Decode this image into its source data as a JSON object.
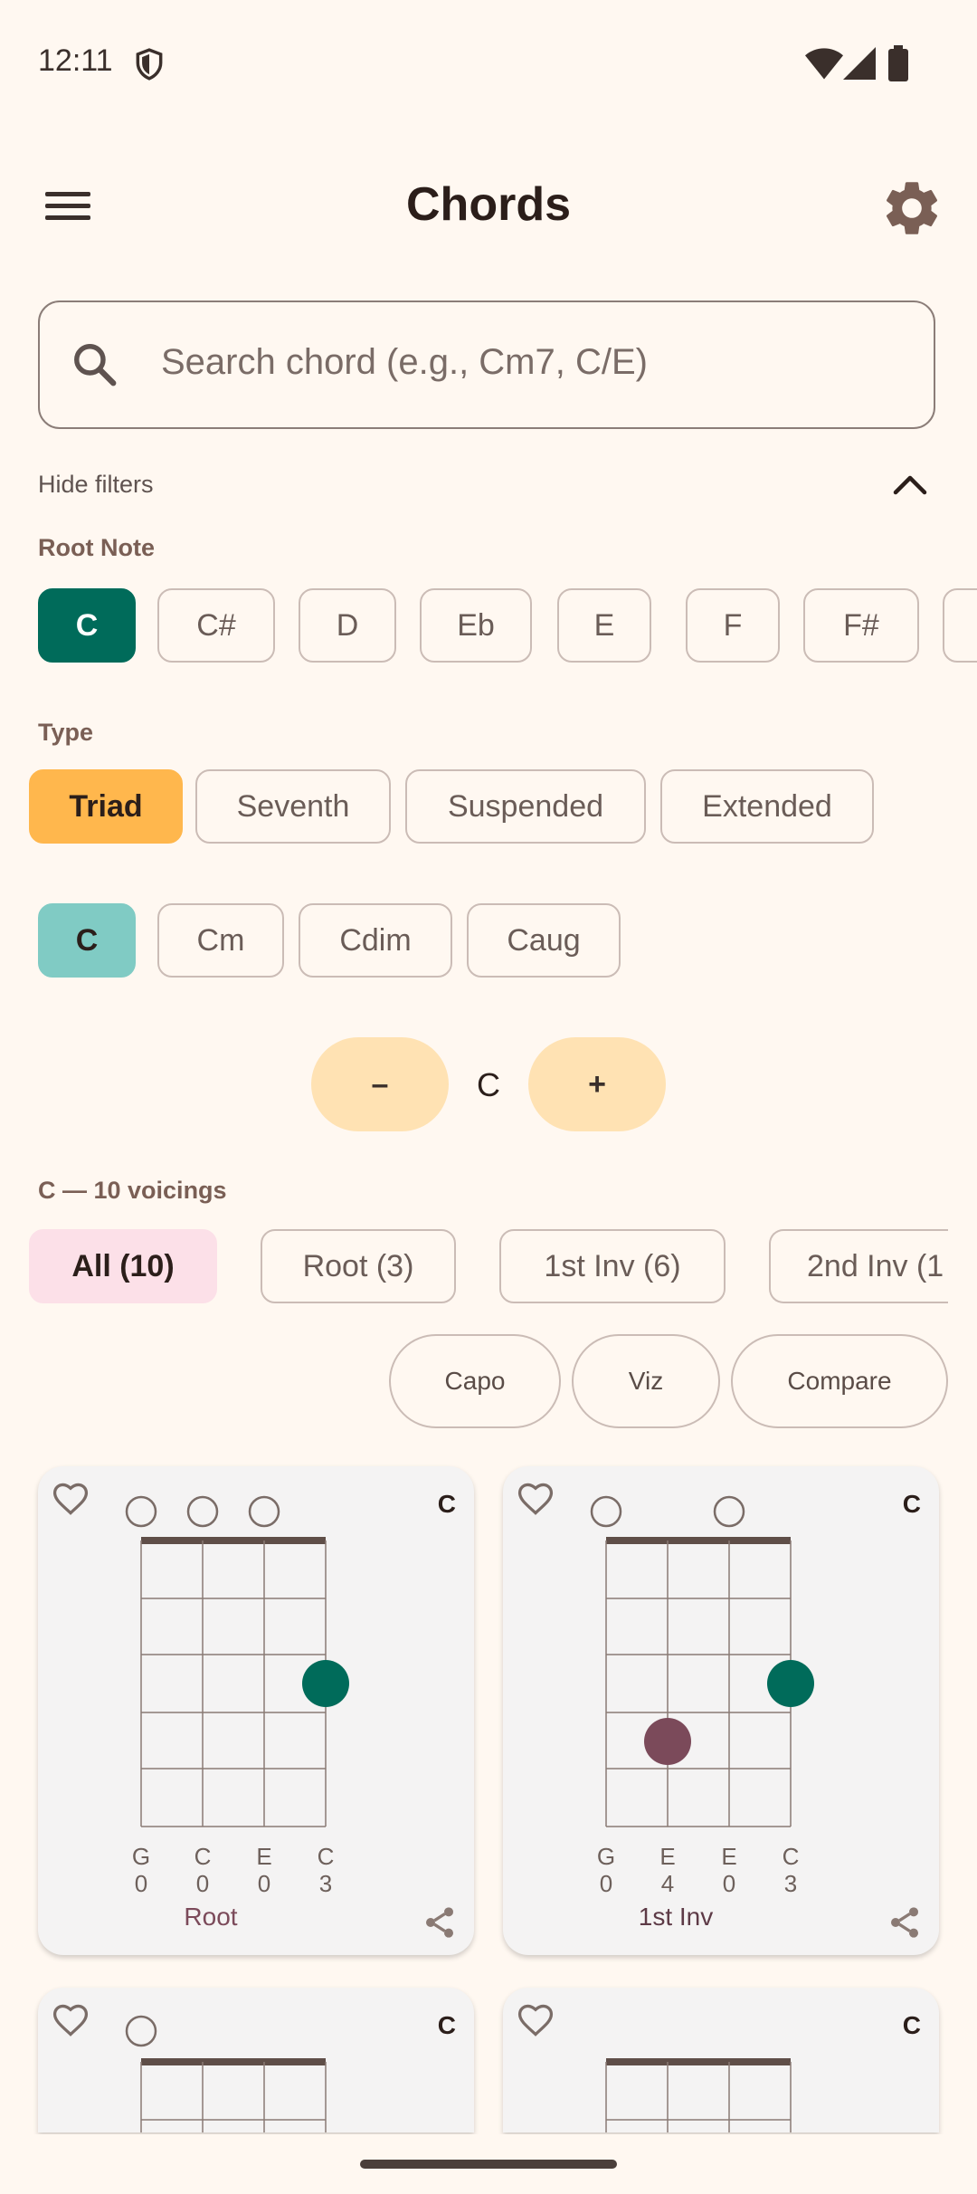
{
  "status": {
    "time": "12:11"
  },
  "app_bar": {
    "title": "Chords"
  },
  "search": {
    "placeholder": "Search chord (e.g., Cm7, C/E)"
  },
  "filters_toggle": "Hide filters",
  "root_note": {
    "label": "Root Note",
    "options": [
      "C",
      "C#",
      "D",
      "Eb",
      "E",
      "F",
      "F#"
    ],
    "selected": "C"
  },
  "type": {
    "label": "Type",
    "options": [
      "Triad",
      "Seventh",
      "Suspended",
      "Extended"
    ],
    "selected": "Triad"
  },
  "variants": {
    "options": [
      "C",
      "Cm",
      "Cdim",
      "Caug"
    ],
    "selected": "C"
  },
  "transpose": {
    "minus": "–",
    "current": "C",
    "plus": "+"
  },
  "voicings": {
    "header": "C — 10 voicings",
    "filters": [
      "All (10)",
      "Root (3)",
      "1st Inv (6)",
      "2nd Inv (1"
    ],
    "selected": "All (10)"
  },
  "actions": {
    "capo": "Capo",
    "viz": "Viz",
    "compare": "Compare"
  },
  "cards": [
    {
      "name": "C",
      "strings": [
        "G",
        "C",
        "E",
        "C"
      ],
      "frets": [
        "0",
        "0",
        "0",
        "3"
      ],
      "label": "Root",
      "label_color": "#7B4A5A"
    },
    {
      "name": "C",
      "strings": [
        "G",
        "E",
        "E",
        "C"
      ],
      "frets": [
        "0",
        "4",
        "0",
        "3"
      ],
      "label": "1st Inv",
      "label_color": "#5D3A46"
    },
    {
      "name": "C"
    },
    {
      "name": "C"
    }
  ],
  "colors": {
    "accent_teal": "#006B5A",
    "dot_root": "#006B5A",
    "dot_third": "#7B4A5A",
    "type_selected": "#FFB74D"
  }
}
